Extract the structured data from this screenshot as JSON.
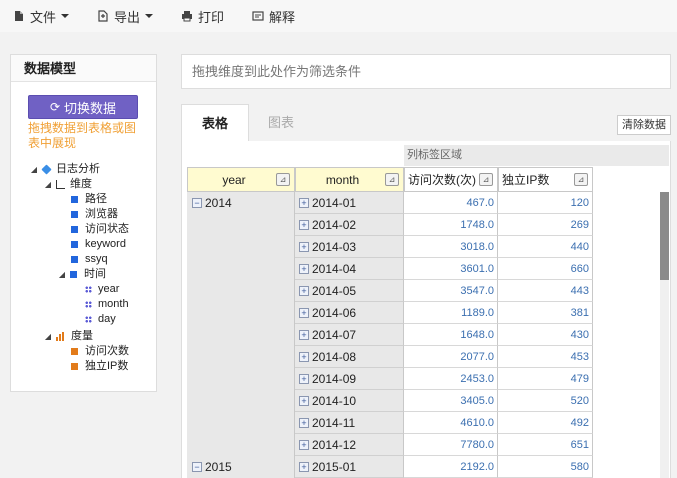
{
  "toolbar": {
    "file": "文件",
    "export": "导出",
    "print": "打印",
    "explain": "解释"
  },
  "left_panel": {
    "title": "数据模型",
    "switch_button": "切换数据",
    "hint": "拖拽数据到表格或图表中展现",
    "tree": {
      "root": "日志分析",
      "dimension_group": "维度",
      "dimensions": [
        "路径",
        "浏览器",
        "访问状态",
        "keyword",
        "ssyq"
      ],
      "time_group": "时间",
      "time_fields": [
        "year",
        "month",
        "day"
      ],
      "measure_group": "度量",
      "measures": [
        "访问次数",
        "独立IP数"
      ]
    }
  },
  "filter_placeholder": "拖拽维度到此处作为筛选条件",
  "tabs": {
    "table": "表格",
    "chart": "图表"
  },
  "clear_button": "清除数据",
  "column_area_label": "列标签区域",
  "headers": [
    "year",
    "month",
    "访问次数(次)",
    "独立IP数"
  ],
  "rows": [
    {
      "year": "2014",
      "month": "2014-01",
      "visits": "467.0",
      "ips": "120"
    },
    {
      "year": "",
      "month": "2014-02",
      "visits": "1748.0",
      "ips": "269"
    },
    {
      "year": "",
      "month": "2014-03",
      "visits": "3018.0",
      "ips": "440"
    },
    {
      "year": "",
      "month": "2014-04",
      "visits": "3601.0",
      "ips": "660"
    },
    {
      "year": "",
      "month": "2014-05",
      "visits": "3547.0",
      "ips": "443"
    },
    {
      "year": "",
      "month": "2014-06",
      "visits": "1189.0",
      "ips": "381"
    },
    {
      "year": "",
      "month": "2014-07",
      "visits": "1648.0",
      "ips": "430"
    },
    {
      "year": "",
      "month": "2014-08",
      "visits": "2077.0",
      "ips": "453"
    },
    {
      "year": "",
      "month": "2014-09",
      "visits": "2453.0",
      "ips": "479"
    },
    {
      "year": "",
      "month": "2014-10",
      "visits": "3405.0",
      "ips": "520"
    },
    {
      "year": "",
      "month": "2014-11",
      "visits": "4610.0",
      "ips": "492"
    },
    {
      "year": "",
      "month": "2014-12",
      "visits": "7780.0",
      "ips": "651"
    },
    {
      "year": "2015",
      "month": "2015-01",
      "visits": "2192.0",
      "ips": "580"
    }
  ]
}
